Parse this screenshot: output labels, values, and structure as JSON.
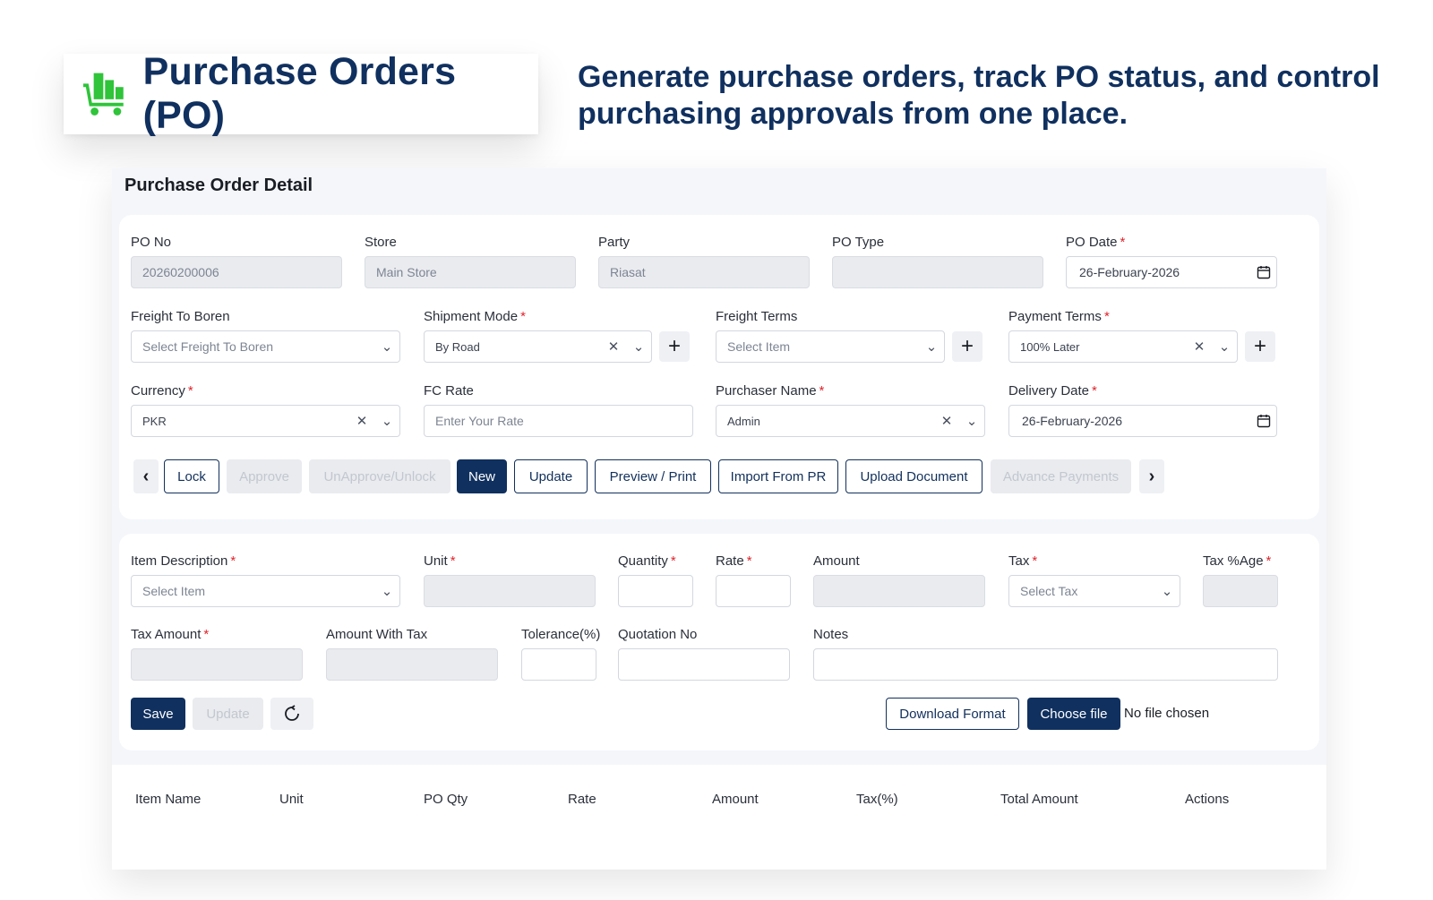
{
  "hero": {
    "title": "Purchase Orders (PO)",
    "tagline": "Generate purchase orders, track PO status, and control purchasing approvals from one place.",
    "logo_icon": "shopping-cart-icon",
    "accent_color": "#2fc43a",
    "brand_color": "#10305f"
  },
  "panel": {
    "title": "Purchase Order Detail"
  },
  "header_form": {
    "po_no": {
      "label": "PO No",
      "value": "20260200006"
    },
    "store": {
      "label": "Store",
      "value": "Main Store"
    },
    "party": {
      "label": "Party",
      "value": "Riasat"
    },
    "po_type": {
      "label": "PO Type",
      "value": ""
    },
    "po_date": {
      "label": "PO Date",
      "value": "26-February-2026"
    },
    "freight_to_boren": {
      "label": "Freight To Boren",
      "placeholder": "Select Freight To Boren"
    },
    "shipment_mode": {
      "label": "Shipment Mode",
      "value": "By Road"
    },
    "freight_terms": {
      "label": "Freight Terms",
      "placeholder": "Select Item"
    },
    "payment_terms": {
      "label": "Payment Terms",
      "value": "100% Later"
    },
    "currency": {
      "label": "Currency",
      "value": "PKR"
    },
    "fc_rate": {
      "label": "FC Rate",
      "placeholder": "Enter Your Rate"
    },
    "purchaser_name": {
      "label": "Purchaser Name",
      "value": "Admin"
    },
    "delivery_date": {
      "label": "Delivery Date",
      "value": "26-February-2026"
    },
    "required_mark": "*"
  },
  "actions": {
    "lock": "Lock",
    "approve": "Approve",
    "unapprove": "UnApprove/Unlock",
    "new": "New",
    "update": "Update",
    "preview": "Preview / Print",
    "import_pr": "Import From PR",
    "upload": "Upload Document",
    "advance": "Advance Payments"
  },
  "item_form": {
    "item_description": {
      "label": "Item Description",
      "placeholder": "Select Item"
    },
    "unit": {
      "label": "Unit"
    },
    "quantity": {
      "label": "Quantity"
    },
    "rate": {
      "label": "Rate"
    },
    "amount": {
      "label": "Amount"
    },
    "tax": {
      "label": "Tax",
      "placeholder": "Select Tax"
    },
    "tax_pct": {
      "label": "Tax %Age"
    },
    "tax_amount": {
      "label": "Tax Amount"
    },
    "amount_with_tax": {
      "label": "Amount With Tax"
    },
    "tolerance": {
      "label": "Tolerance(%)"
    },
    "quotation_no": {
      "label": "Quotation No"
    },
    "notes": {
      "label": "Notes"
    },
    "save": "Save",
    "update": "Update",
    "download_format": "Download Format",
    "choose_file": "Choose file",
    "no_file": "No file chosen"
  },
  "table": {
    "columns": [
      "Item Name",
      "Unit",
      "PO Qty",
      "Rate",
      "Amount",
      "Tax(%)",
      "Total Amount",
      "Actions"
    ]
  }
}
